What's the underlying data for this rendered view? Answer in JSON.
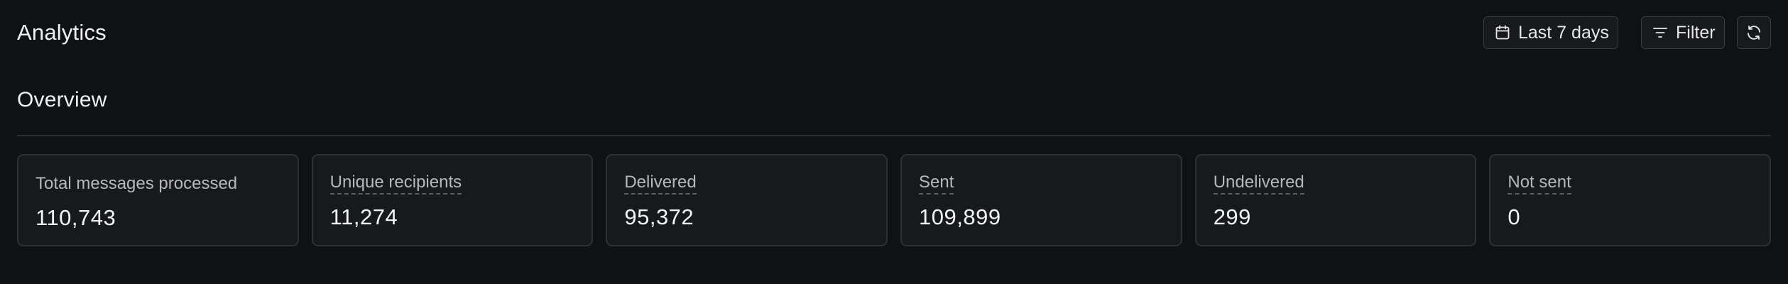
{
  "header": {
    "title": "Analytics",
    "date_range_label": "Last 7 days",
    "filter_label": "Filter"
  },
  "overview": {
    "title": "Overview",
    "stats": [
      {
        "label": "Total messages processed",
        "value": "110,743"
      },
      {
        "label": "Unique recipients",
        "value": "11,274"
      },
      {
        "label": "Delivered",
        "value": "95,372"
      },
      {
        "label": "Sent",
        "value": "109,899"
      },
      {
        "label": "Undelivered",
        "value": "299"
      },
      {
        "label": "Not sent",
        "value": "0"
      }
    ]
  },
  "icons": {
    "date_range": "calendar-icon",
    "filter": "filter-icon",
    "refresh": "refresh-icon"
  },
  "colors": {
    "background": "#101113",
    "card_background": "#18191c",
    "border": "#2e3034",
    "text_primary": "#f0f1f3",
    "text_secondary": "#b6b8bc"
  }
}
